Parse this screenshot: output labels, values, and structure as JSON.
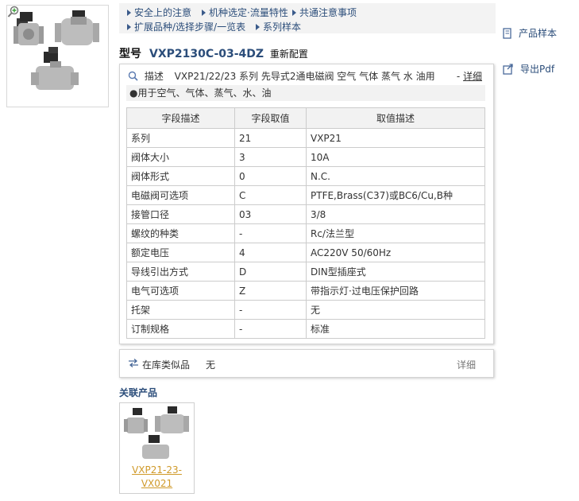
{
  "nav": {
    "links": [
      "安全上的注意",
      "机种选定·流量特性",
      "共通注意事项",
      "扩展品种/选择步骤/一览表",
      "系列样本"
    ]
  },
  "model": {
    "label": "型号",
    "code": "VXP2130C-03-4DZ",
    "reset": "重新配置"
  },
  "side": {
    "catalog": "产品样本",
    "export_pdf": "导出Pdf"
  },
  "description": {
    "label": "描述",
    "text": "VXP21/22/23 系列 先导式2通电磁阀 空气 气体 蒸气 水 油用",
    "more_prefix": "- ",
    "more": "详细",
    "usage": "●用于空气、气体、蒸气、水、油"
  },
  "table": {
    "headers": [
      "字段描述",
      "字段取值",
      "取值描述"
    ],
    "rows": [
      [
        "系列",
        "21",
        "VXP21"
      ],
      [
        "阀体大小",
        "3",
        "10A"
      ],
      [
        "阀体形式",
        "0",
        "N.C."
      ],
      [
        "电磁阀可选项",
        "C",
        "PTFE,Brass(C37)或BC6/Cu,B种"
      ],
      [
        "接管口径",
        "03",
        "3/8"
      ],
      [
        "螺纹的种类",
        "-",
        "Rc/法兰型"
      ],
      [
        "额定电压",
        "4",
        "AC220V 50/60Hz"
      ],
      [
        "导线引出方式",
        "D",
        "DIN型插座式"
      ],
      [
        "电气可选项",
        "Z",
        "带指示灯·过电压保护回路"
      ],
      [
        "托架",
        "-",
        "无"
      ],
      [
        "订制规格",
        "-",
        "标准"
      ]
    ]
  },
  "stock": {
    "label": "在库类似品",
    "value": "无",
    "more": "详细"
  },
  "related": {
    "title": "关联产品",
    "items": [
      {
        "name_line1": "VXP21-23-",
        "name_line2": "VX021"
      }
    ]
  },
  "colors": {
    "link_blue": "#2b4d7a",
    "related_name": "#d09a2a",
    "header_bg": "#f2f2f2"
  }
}
